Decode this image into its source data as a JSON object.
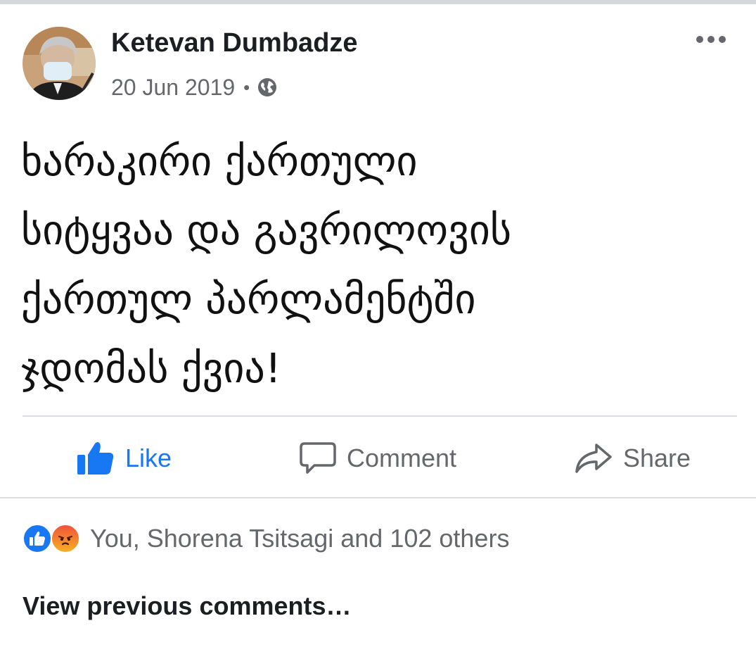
{
  "post": {
    "author_name": "Ketevan Dumbadze",
    "timestamp": "20 Jun 2019",
    "separator": "•",
    "privacy_icon": "globe-icon",
    "more_icon": "more-horizontal-icon",
    "avatar": "profile-photo-woman-with-face-mask",
    "text_lines": [
      "ხარაკირი ქართული",
      "სიტყვაა და გავრილოვის",
      "ქართულ პარლამენტში",
      "ჯდომას ქვია!"
    ]
  },
  "actions": {
    "like_label": "Like",
    "comment_label": "Comment",
    "share_label": "Share"
  },
  "reactions": {
    "summary": "You, Shorena Tsitsagi and 102 others",
    "icons": [
      "like-reaction-icon",
      "angry-reaction-icon"
    ]
  },
  "comments": {
    "view_previous_label": "View previous comments…"
  },
  "colors": {
    "accent": "#1877f2",
    "text_primary": "#1c1e21",
    "text_secondary": "#65676b",
    "divider": "#dcdde0"
  }
}
